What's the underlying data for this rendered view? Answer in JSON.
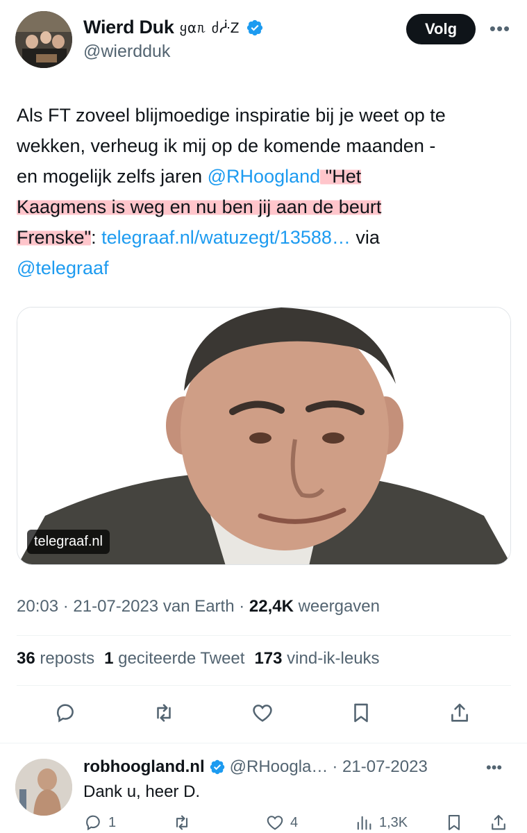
{
  "author": {
    "display_name": "Wierd Duk",
    "name_suffix": "ყαᥰ ძᓿᏃ",
    "handle": "@wierdduk",
    "follow_label": "Volg",
    "more_label": "•••"
  },
  "tweet": {
    "lines": [
      "Als FT zoveel blijmoedige inspiratie bij je weet op te",
      "wekken, verheug ik mij op de komende maanden -",
      "en mogelijk zelfs jaren "
    ],
    "mention": "@RHoogland",
    "quote_part1": " \"Het",
    "quote_part2": "Kaagmens is weg en nu ben jij aan de beurt",
    "quote_part3": "Frenske\"",
    "colon": ": ",
    "link": "telegraaf.nl/watuzegt/13588…",
    "via": " via",
    "via_mention": "@telegraaf"
  },
  "card": {
    "domain": "telegraaf.nl"
  },
  "meta": {
    "time": "20:03 · 21-07-2023 van Earth · ",
    "views": "22,4K",
    "views_label": " weergaven"
  },
  "stats": {
    "reposts": "36",
    "reposts_label": " reposts",
    "quotes": "1",
    "quotes_label": " geciteerde Tweet",
    "likes": "173",
    "likes_label": " vind-ik-leuks"
  },
  "reply": {
    "name": "robhoogland.nl",
    "handle": "@RHoogla…",
    "date": "· 21-07-2023",
    "more_label": "•••",
    "text": "Dank u, heer D.",
    "replies": "1",
    "likes": "4",
    "views": "1,3K"
  },
  "colors": {
    "link": "#1d9bf0",
    "highlight": "#ff96a0",
    "verified": "#1d9bf0",
    "secondary_text": "#536471"
  }
}
